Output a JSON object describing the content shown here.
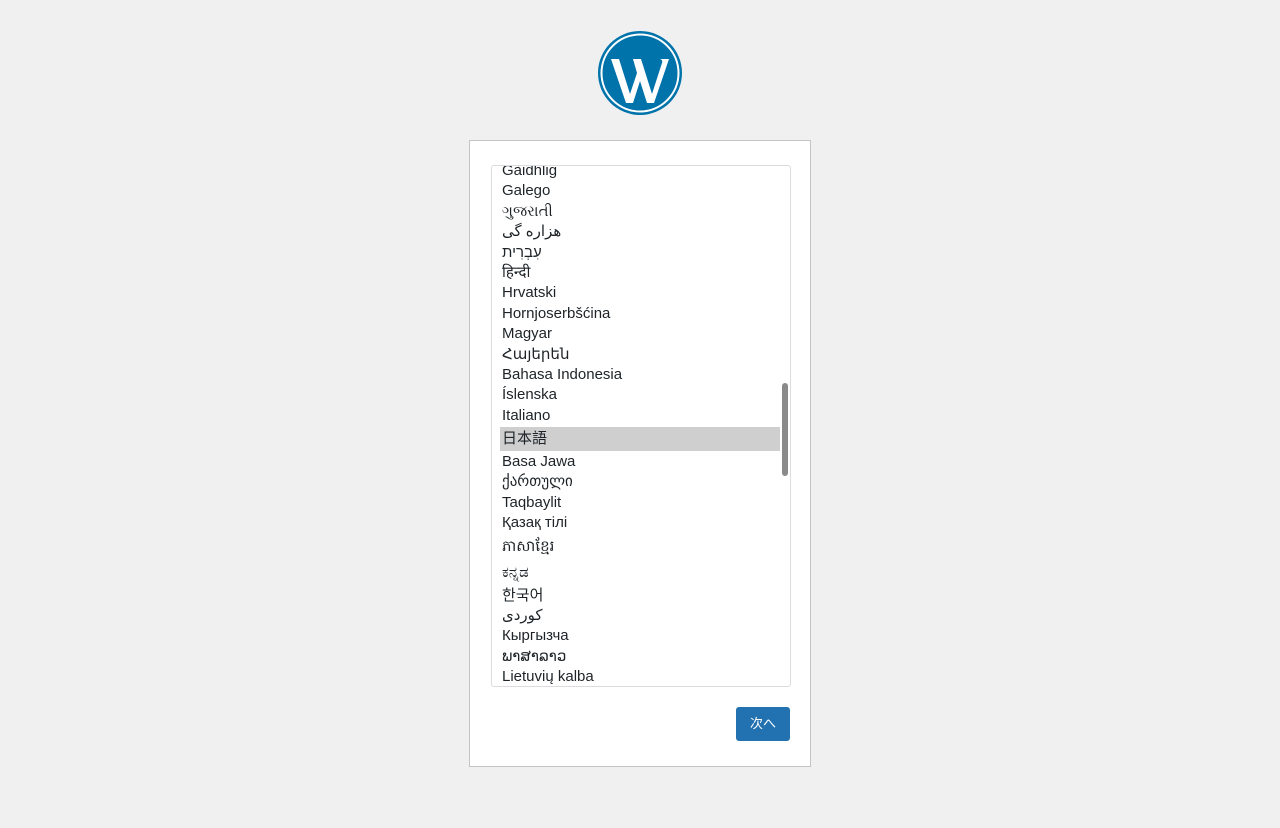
{
  "logo": {
    "name": "wordpress-logo",
    "color": "#0073aa"
  },
  "language_list": {
    "selected": "日本語",
    "items": [
      "Gàidhlig",
      "Galego",
      "ગુજરાતી",
      "هزاره گی",
      "עִבְרִית",
      "हिन्दी",
      "Hrvatski",
      "Hornjoserbšćina",
      "Magyar",
      "Հայերեն",
      "Bahasa Indonesia",
      "Íslenska",
      "Italiano",
      "日本語",
      "Basa Jawa",
      "ქართული",
      "Taqbaylit",
      "Қазақ тілі",
      "ភាសាខ្មែរ",
      "ಕನ್ನಡ",
      "한국어",
      "كوردی",
      "Кыргызча",
      "ພາສາລາວ",
      "Lietuvių kalba"
    ]
  },
  "next_button": {
    "label": "次へ",
    "color": "#2271b1"
  }
}
